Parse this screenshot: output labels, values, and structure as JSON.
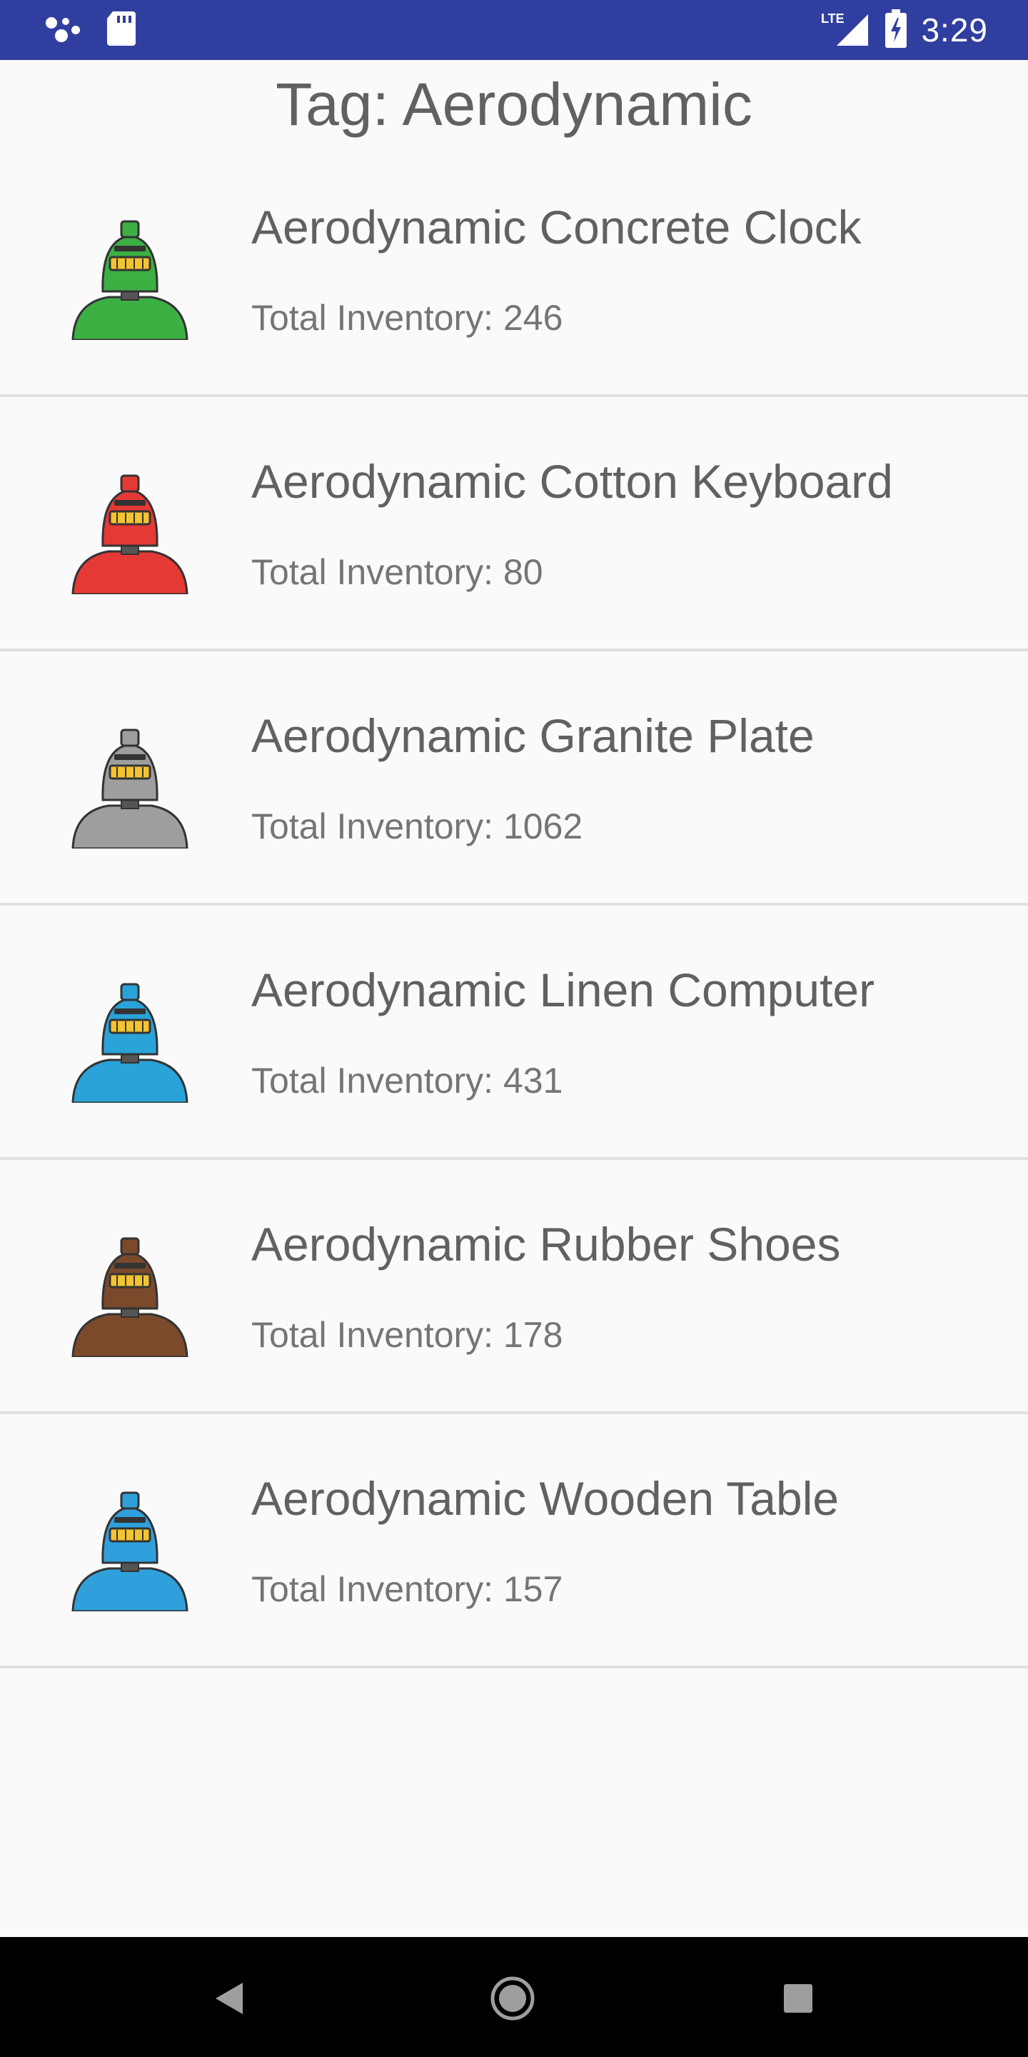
{
  "status_bar": {
    "time": "3:29",
    "network": "LTE",
    "icons": [
      "assistant-icon",
      "sd-card-icon",
      "lte-signal-icon",
      "battery-charging-icon"
    ]
  },
  "page": {
    "title": "Tag: Aerodynamic"
  },
  "items": [
    {
      "name": "Aerodynamic Concrete Clock",
      "inventory": "Total Inventory: 246",
      "avatar_color": "#3cb043"
    },
    {
      "name": "Aerodynamic Cotton Keyboard",
      "inventory": "Total Inventory: 80",
      "avatar_color": "#e53935"
    },
    {
      "name": "Aerodynamic Granite Plate",
      "inventory": "Total Inventory: 1062",
      "avatar_color": "#9e9e9e"
    },
    {
      "name": "Aerodynamic Linen Computer",
      "inventory": "Total Inventory: 431",
      "avatar_color": "#29a3d8"
    },
    {
      "name": "Aerodynamic Rubber Shoes",
      "inventory": "Total Inventory: 178",
      "avatar_color": "#7b4a2a"
    },
    {
      "name": "Aerodynamic Wooden Table",
      "inventory": "Total Inventory: 157",
      "avatar_color": "#2fa0dc"
    }
  ],
  "nav_bar": {
    "buttons": [
      "back-icon",
      "home-icon",
      "recents-icon"
    ]
  },
  "colors": {
    "status_bar": "#303f9f",
    "background": "#fafafa",
    "divider": "#e0e0e0",
    "text_primary": "#616161"
  }
}
